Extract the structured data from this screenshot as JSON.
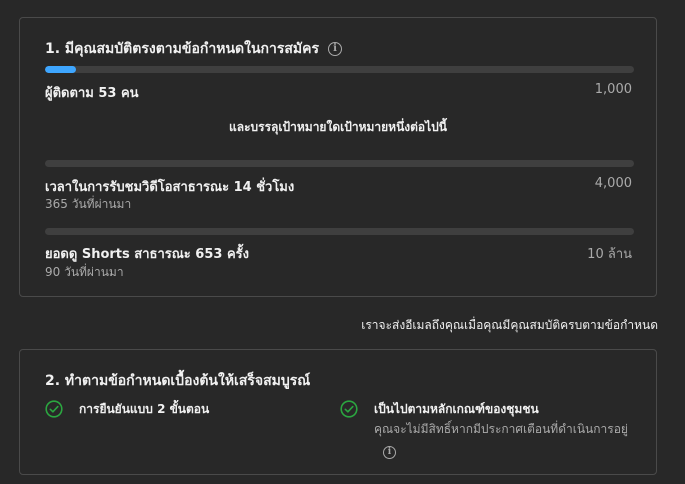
{
  "section1": {
    "title": "1. มีคุณสมบัติตรงตามข้อกำหนดในการสมัคร",
    "info_icon": "i",
    "subscribers": {
      "label": "ผู้ติดตาม 53 คน",
      "target": "1,000",
      "progress_fraction": 0.053
    },
    "middle_text": "และบรรลุเป้าหมายใดเป้าหมายหนึ่งต่อไปนี้",
    "watch_time": {
      "label": "เวลาในการรับชมวิดีโอสาธารณะ 14 ชั่วโมง",
      "target": "4,000",
      "sub": "365 วันที่ผ่านมา",
      "progress_fraction": 0.0035
    },
    "shorts_views": {
      "label": "ยอดดู Shorts สาธารณะ 653 ครั้ง",
      "target": "10 ล้าน",
      "sub": "90 วันที่ผ่านมา",
      "progress_fraction": 0.0001
    }
  },
  "email_note": "เราจะส่งอีเมลถึงคุณเมื่อคุณมีคุณสมบัติครบตามข้อกำหนด",
  "section2": {
    "title": "2. ทำตามข้อกำหนดเบื้องต้นให้เสร็จสมบูรณ์",
    "items": [
      {
        "label": "การยืนยันแบบ 2 ขั้นตอน",
        "sub": ""
      },
      {
        "label": "เป็นไปตามหลักเกณฑ์ของชุมชน",
        "sub": "คุณจะไม่มีสิทธิ์หากมีประกาศเตือนที่ดำเนินการอยู่"
      }
    ],
    "info_icon": "i"
  },
  "colors": {
    "background": "#282828",
    "card_border": "#4a4a4a",
    "progress_fill": "#3ea6ff",
    "progress_track": "#3f3f3f",
    "check_green": "#2ba640"
  }
}
